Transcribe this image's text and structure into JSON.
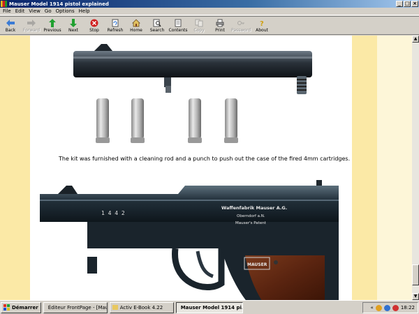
{
  "window": {
    "title": "Mauser Model 1914 pistol explained"
  },
  "menu": [
    "File",
    "Edit",
    "View",
    "Go",
    "Options",
    "Help"
  ],
  "toolbar": [
    {
      "label": "Back",
      "icon": "back-arrow-icon",
      "enabled": true
    },
    {
      "label": "Forward",
      "icon": "forward-arrow-icon",
      "enabled": false
    },
    {
      "label": "Previous",
      "icon": "up-arrow-icon",
      "enabled": true
    },
    {
      "label": "Next",
      "icon": "down-arrow-icon",
      "enabled": true
    },
    {
      "label": "Stop",
      "icon": "stop-icon",
      "enabled": true
    },
    {
      "label": "Refresh",
      "icon": "refresh-icon",
      "enabled": true
    },
    {
      "label": "Home",
      "icon": "home-icon",
      "enabled": true
    },
    {
      "label": "Search",
      "icon": "search-icon",
      "enabled": true
    },
    {
      "label": "Contents",
      "icon": "contents-icon",
      "enabled": true
    },
    {
      "label": "Copy",
      "icon": "copy-icon",
      "enabled": false
    },
    {
      "label": "Print",
      "icon": "print-icon",
      "enabled": true
    },
    {
      "label": "Password",
      "icon": "password-icon",
      "enabled": false
    },
    {
      "label": "About",
      "icon": "about-icon",
      "enabled": true
    }
  ],
  "content": {
    "caption": "The kit was furnished with a cleaning rod and a punch to push out the case of the fired 4mm cartridges.",
    "pistol": {
      "serial": "1 4 4 2",
      "inscription_line1": "Waffenfabrik  Mauser A.G.",
      "inscription_line2": "Oberndorf a.N.",
      "inscription_line3": "Mauser's Patent",
      "logo_text": "MAUSER"
    }
  },
  "taskbar": {
    "start_label": "Démarrer",
    "tasks": [
      {
        "label": "Éditeur FrontPage - [Mau...",
        "active": false
      },
      {
        "label": "Activ E-Book 4.22",
        "active": false
      },
      {
        "label": "Mauser Model 1914 pi...",
        "active": true
      }
    ],
    "clock": "18:22"
  },
  "colors": {
    "page_margin": "#fbe9a6",
    "page_margin_light": "#fdf6d8",
    "titlebar": "#0a246a"
  }
}
